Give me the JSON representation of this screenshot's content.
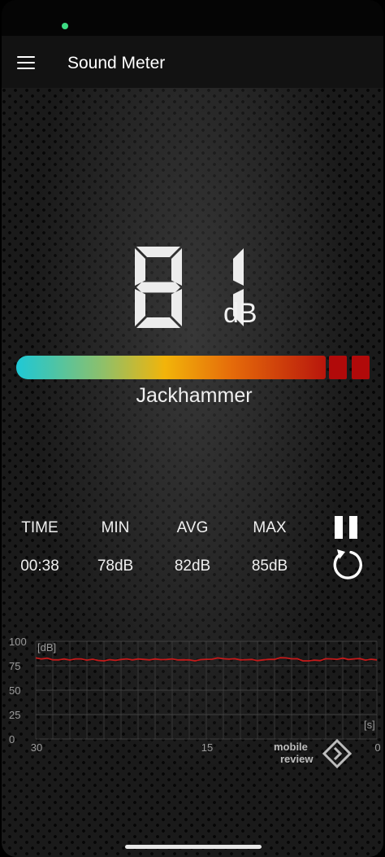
{
  "app": {
    "title": "Sound Meter"
  },
  "meter": {
    "reading": "81",
    "unit": "dB",
    "description": "Jackhammer",
    "level_percent": 81
  },
  "stats": {
    "time": {
      "label": "TIME",
      "value": "00:38"
    },
    "min": {
      "label": "MIN",
      "value": "78dB"
    },
    "avg": {
      "label": "AVG",
      "value": "82dB"
    },
    "max": {
      "label": "MAX",
      "value": "85dB"
    }
  },
  "controls": {
    "pause_icon": "pause-icon",
    "reset_icon": "refresh-icon"
  },
  "graph": {
    "y_unit": "[dB]",
    "x_unit": "[s]",
    "y_ticks": [
      "100",
      "75",
      "50",
      "25",
      "0"
    ],
    "x_ticks": [
      "30",
      "15",
      "0"
    ],
    "line_color": "#c41a1a"
  },
  "chart_data": {
    "type": "line",
    "title": "",
    "xlabel": "[s]",
    "ylabel": "[dB]",
    "xlim": [
      30,
      0
    ],
    "ylim": [
      0,
      100
    ],
    "grid": true,
    "x": [
      30,
      28,
      26,
      24,
      22,
      20,
      18,
      16,
      14,
      12,
      10,
      8,
      6,
      4,
      2,
      0
    ],
    "series": [
      {
        "values": [
          83,
          81,
          82,
          80,
          82,
          81,
          82,
          80,
          83,
          81,
          81,
          83,
          80,
          82,
          82,
          81
        ]
      }
    ]
  },
  "watermark": {
    "line1": "mobile",
    "line2": "review"
  },
  "colors": {
    "gauge_start": "#1fc8d6",
    "gauge_mid": "#f2b40a",
    "gauge_end": "#b8160c",
    "segment": "#b10a0a"
  }
}
